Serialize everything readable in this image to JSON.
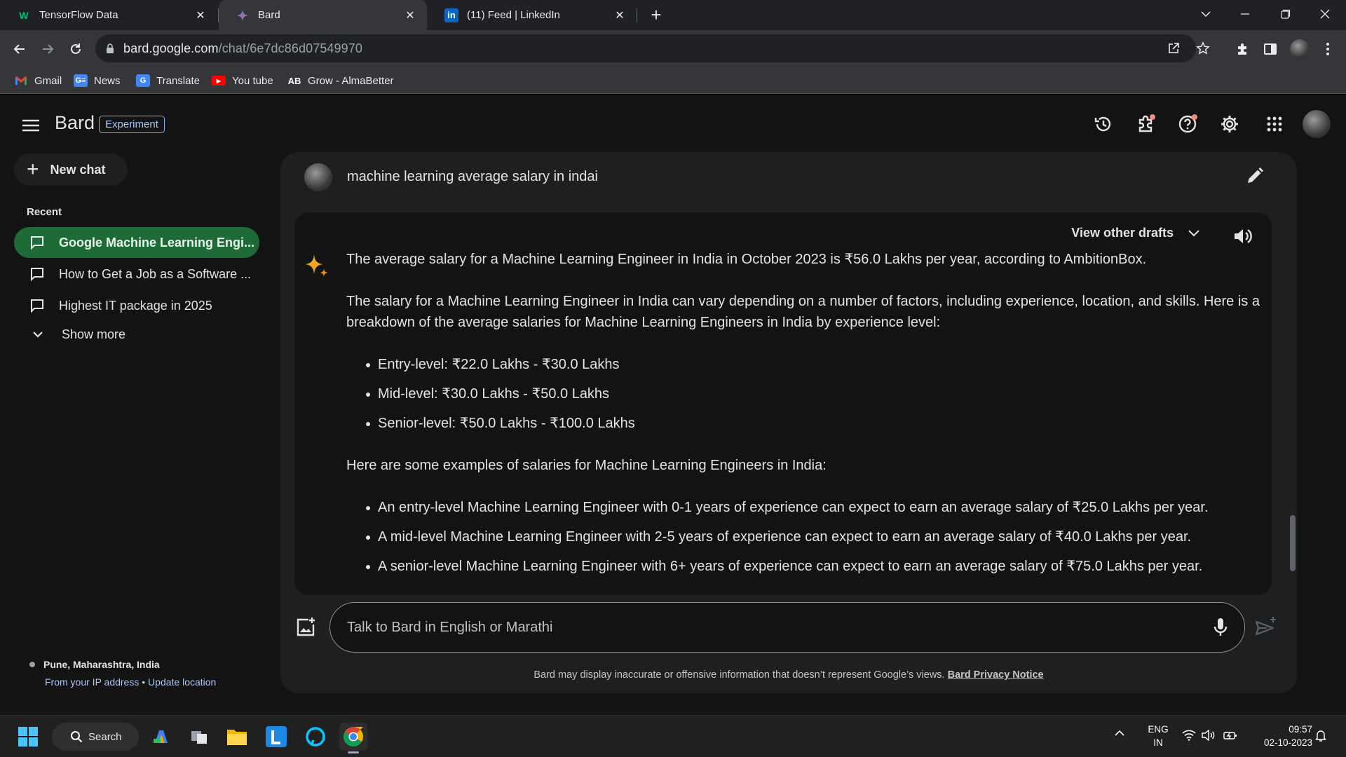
{
  "browser": {
    "tabs": [
      {
        "title": "TensorFlow Data",
        "favicon": "W"
      },
      {
        "title": "Bard",
        "favicon": "sparkle"
      },
      {
        "title": "(11) Feed | LinkedIn",
        "favicon": "in"
      }
    ],
    "url_host": "bard.google.com",
    "url_path": "/chat/6e7dc86d07549970",
    "bookmarks": [
      "Gmail",
      "News",
      "Translate",
      "You tube",
      "Grow - AlmaBetter"
    ]
  },
  "app": {
    "name": "Bard",
    "badge": "Experiment",
    "new_chat": "New chat",
    "recent_heading": "Recent",
    "recent_chats": [
      "Google Machine Learning Engi...",
      "How to Get a Job as a Software ...",
      "Highest IT package in 2025"
    ],
    "show_more": "Show more",
    "location": "Pune, Maharashtra, India",
    "location_source": "From your IP address",
    "location_sep": "•",
    "update_location": "Update location"
  },
  "chat": {
    "query": "machine learning average salary in indai",
    "view_drafts": "View other drafts",
    "response": {
      "p1": "The average salary for a Machine Learning Engineer in India in October 2023 is ₹56.0 Lakhs per year, according to AmbitionBox.",
      "p2": "The salary for a Machine Learning Engineer in India can vary depending on a number of factors, including experience, location, and skills. Here is a breakdown of the average salaries for Machine Learning Engineers in India by experience level:",
      "levels": [
        "Entry-level: ₹22.0 Lakhs - ₹30.0 Lakhs",
        "Mid-level: ₹30.0 Lakhs - ₹50.0 Lakhs",
        "Senior-level: ₹50.0 Lakhs - ₹100.0 Lakhs"
      ],
      "p3": "Here are some examples of salaries for Machine Learning Engineers in India:",
      "examples": [
        "An entry-level Machine Learning Engineer with 0-1 years of experience can expect to earn an average salary of ₹25.0 Lakhs per year.",
        "A mid-level Machine Learning Engineer with 2-5 years of experience can expect to earn an average salary of ₹40.0 Lakhs per year.",
        "A senior-level Machine Learning Engineer with 6+ years of experience can expect to earn an average salary of ₹75.0 Lakhs per year."
      ]
    },
    "input_placeholder": "Talk to Bard in English or Marathi",
    "disclaimer": "Bard may display inaccurate or offensive information that doesn’t represent Google’s views.",
    "privacy_link": "Bard Privacy Notice"
  },
  "taskbar": {
    "search_label": "Search",
    "lang_top": "ENG",
    "lang_bottom": "IN",
    "time": "09:57",
    "date": "02-10-2023"
  },
  "colors": {
    "selected_chat": "#1e6b38",
    "link": "#a8c7fa",
    "panel": "#1e1f20",
    "notification_dot": "#f28b82"
  }
}
